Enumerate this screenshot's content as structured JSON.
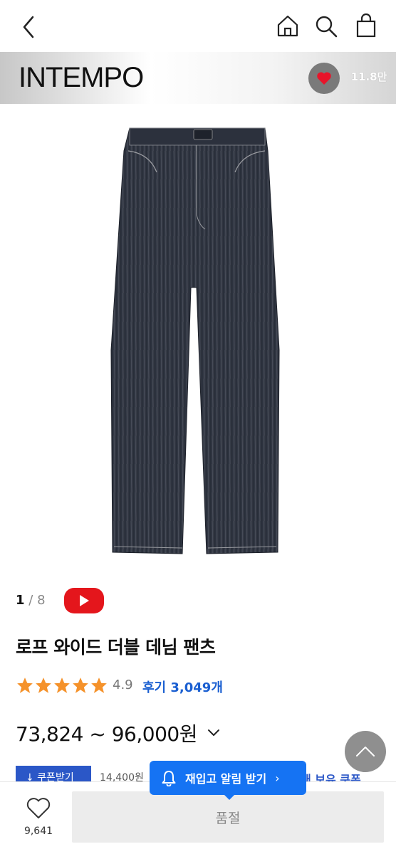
{
  "header": {
    "back_icon": "chevron-left-icon",
    "home_icon": "home-icon",
    "search_icon": "search-icon",
    "cart_icon": "shopping-bag-icon"
  },
  "brand": {
    "name": "INTEMPO",
    "like_count": "11.8만",
    "like_color": "#e8142a"
  },
  "product": {
    "image_icon": "denim-pants-image",
    "image_index": "1",
    "image_separator": "/",
    "image_total": "8",
    "youtube_icon": "youtube-play-icon",
    "title": "로프 와이드 더블 데님 팬츠",
    "rating": "4.9",
    "star_count": 5,
    "reviews": "후기 3,049개",
    "price": "73,824 ~ 96,000원",
    "star_color": "#f5922b"
  },
  "coupon": {
    "button_label": "↓ 쿠폰받기",
    "amount": "14,400원",
    "right_text": "새 보유 쿠폰"
  },
  "restock": {
    "label": "재입고 알림 받기",
    "arrow": "›",
    "color": "#1573f3"
  },
  "bottom": {
    "wish_count": "9,641",
    "soldout_label": "품절"
  }
}
